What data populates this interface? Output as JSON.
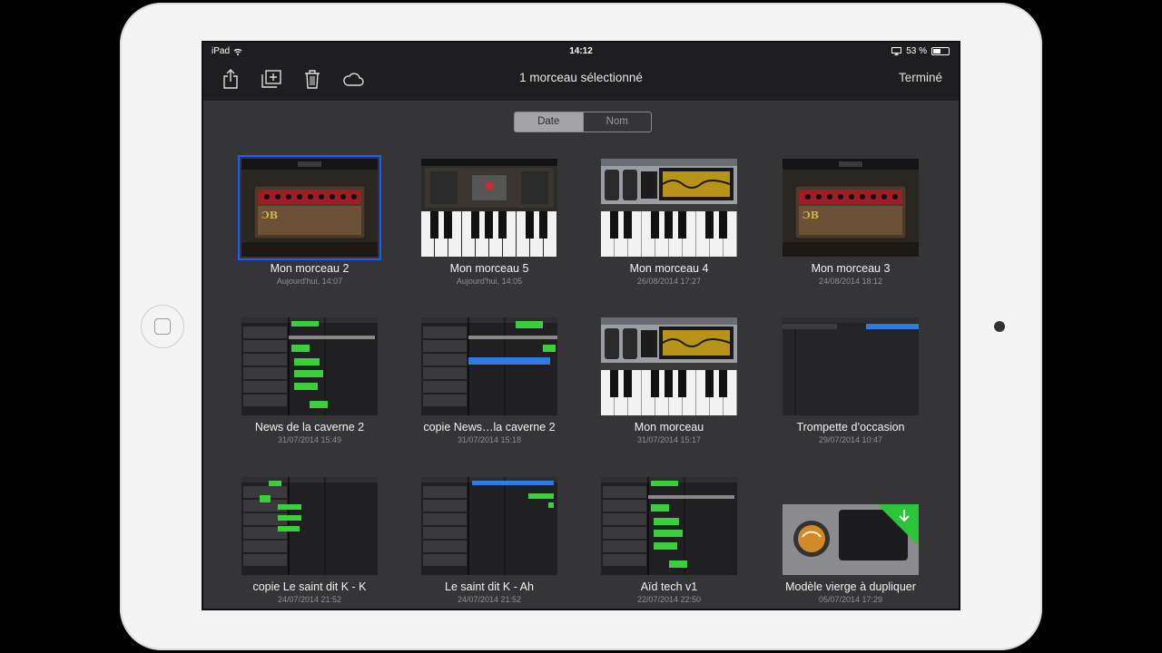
{
  "status_bar": {
    "device": "iPad",
    "time": "14:12",
    "battery": "53 %",
    "battery_level": 0.53
  },
  "toolbar": {
    "title": "1 morceau sélectionné",
    "done_label": "Terminé",
    "icons": [
      "share-icon",
      "duplicate-icon",
      "trash-icon",
      "cloud-icon"
    ]
  },
  "sort": {
    "options": [
      "Date",
      "Nom"
    ],
    "selected": "Date"
  },
  "songs": [
    {
      "name": "Mon morceau 2",
      "date": "Aujourd'hui, 14:07",
      "kind": "amp",
      "selected": true
    },
    {
      "name": "Mon morceau 5",
      "date": "Aujourd'hui, 14:05",
      "kind": "piano"
    },
    {
      "name": "Mon morceau 4",
      "date": "26/08/2014 17:27",
      "kind": "synth"
    },
    {
      "name": "Mon morceau 3",
      "date": "24/08/2014 18:12",
      "kind": "amp"
    },
    {
      "name": "News de la caverne 2",
      "date": "31/07/2014 15:49",
      "kind": "tracks"
    },
    {
      "name": "copie News…la caverne 2",
      "date": "31/07/2014 15:18",
      "kind": "tracks"
    },
    {
      "name": "Mon morceau",
      "date": "31/07/2014 15:17",
      "kind": "synth"
    },
    {
      "name": "Trompette d’occasion",
      "date": "29/07/2014 10:47",
      "kind": "tracks-empty"
    },
    {
      "name": "copie Le saint dit K - K",
      "date": "24/07/2014 21:52",
      "kind": "tracks"
    },
    {
      "name": "Le saint dit K - Ah",
      "date": "24/07/2014 21:52",
      "kind": "tracks"
    },
    {
      "name": "Aïd tech v1",
      "date": "22/07/2014 22:50",
      "kind": "tracks"
    },
    {
      "name": "Modèle vierge à dupliquer",
      "date": "05/07/2014 17:29",
      "kind": "template"
    }
  ],
  "colors": {
    "selection": "#1e5bff",
    "region_green": "#3ccf3c",
    "region_blue": "#2f7be0",
    "template_badge": "#2ec43a"
  }
}
